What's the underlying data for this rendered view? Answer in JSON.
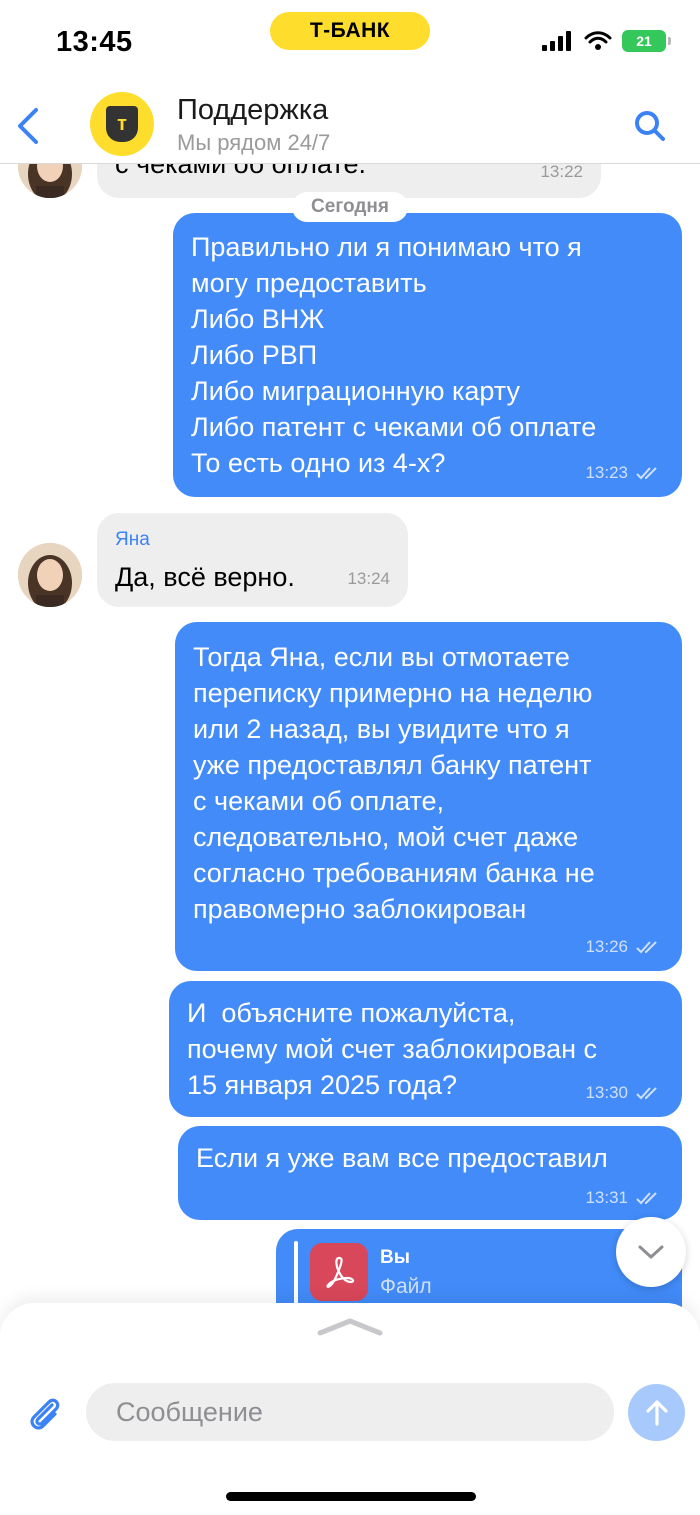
{
  "status_bar": {
    "time": "13:45",
    "brand": "Т‑БАНК",
    "battery": "21"
  },
  "header": {
    "title": "Поддержка",
    "subtitle": "Мы рядом 24/7",
    "logo_letter": "т"
  },
  "date_separator": "Сегодня",
  "messages": [
    {
      "direction": "in",
      "text": "с чеками об оплате.",
      "time": "13:22"
    },
    {
      "direction": "out",
      "text": "Правильно ли я понимаю что я\nмогу предоставить\nЛибо ВНЖ\nЛибо РВП\nЛибо миграционную карту\nЛибо патент с чеками об оплате\nТо есть одно из 4-х?",
      "time": "13:23"
    },
    {
      "direction": "in",
      "sender": "Яна",
      "text": "Да, всё верно.",
      "time": "13:24"
    },
    {
      "direction": "out",
      "text": "Тогда Яна, если вы отмотаете\nпереписку примерно на неделю\nили 2 назад, вы увидите что я\nуже предоставлял банку патент\nс чеками об оплате,\nследовательно, мой счет даже\nсогласно требованиям банка не\nправомерно заблокирован",
      "time": "13:26"
    },
    {
      "direction": "out",
      "text": "И  объясните пожалуйста,\nпочему мой счет заблокирован с\n15 января 2025 года?",
      "time": "13:30"
    },
    {
      "direction": "out",
      "text": "Если я уже вам все предоставил",
      "time": "13:31"
    },
    {
      "direction": "out",
      "reply_author": "Вы",
      "reply_text": "Файл"
    }
  ],
  "composer": {
    "placeholder": "Сообщение"
  },
  "colors": {
    "outgoing_bubble": "#428bf9",
    "incoming_bubble": "#eeeeef",
    "brand_yellow": "#ffdd2d",
    "accent_blue": "#3b82f6"
  },
  "icons": [
    "back-icon",
    "search-icon",
    "read-receipt-icon",
    "chevron-down-icon",
    "attach-icon",
    "send-arrow-icon",
    "pdf-icon"
  ]
}
